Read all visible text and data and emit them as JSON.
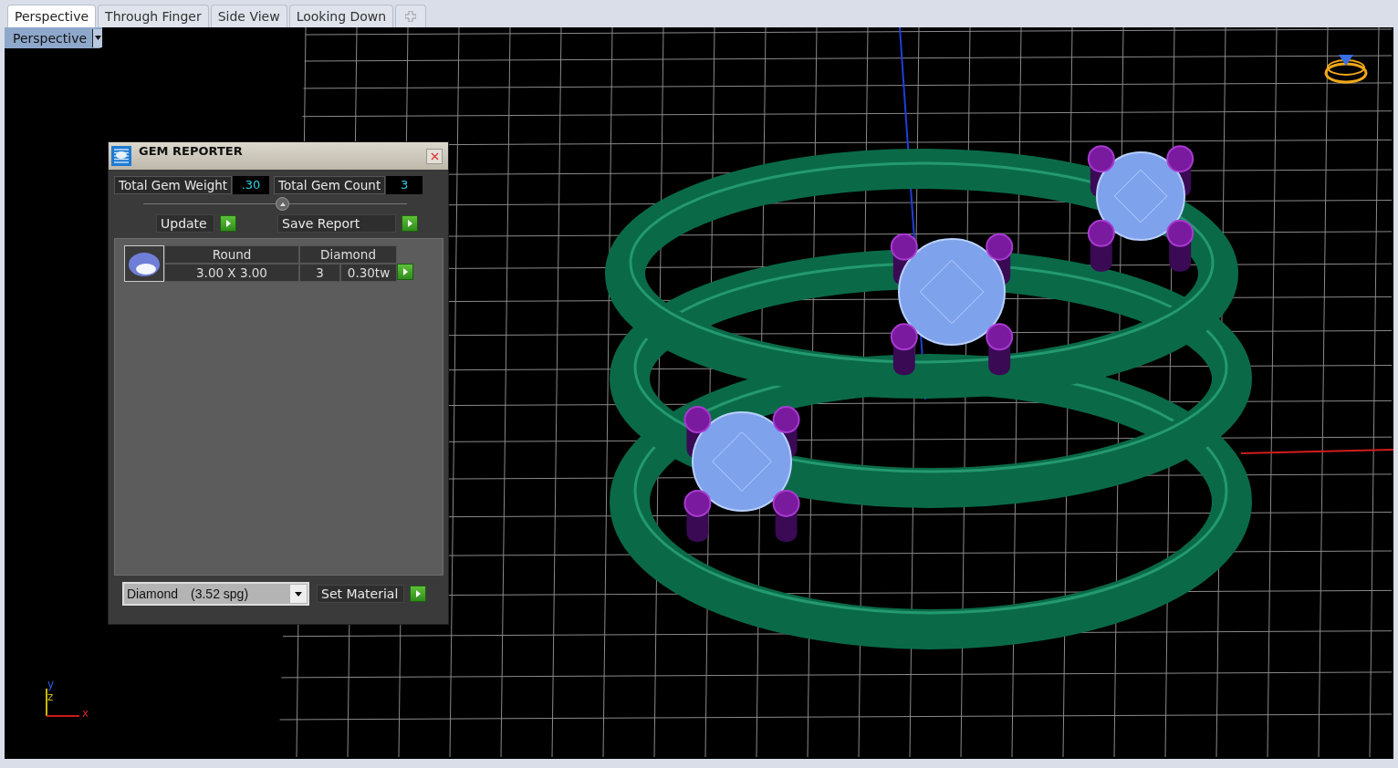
{
  "tabs": [
    {
      "label": "Perspective",
      "selected": true
    },
    {
      "label": "Through Finger",
      "selected": false
    },
    {
      "label": "Side View",
      "selected": false
    },
    {
      "label": "Looking Down",
      "selected": false
    }
  ],
  "viewport": {
    "label": "Perspective",
    "axes": {
      "y": "y",
      "z": "z",
      "x": "x"
    }
  },
  "gem_reporter": {
    "title": "GEM REPORTER",
    "totals": [
      {
        "label": "Total Gem Weight",
        "value": ".30"
      },
      {
        "label": "Total Gem Count",
        "value": "3"
      }
    ],
    "buttons": [
      "Update",
      "Save Report"
    ],
    "gems": [
      {
        "shape": "Round",
        "material": "Diamond",
        "size": "3.00 X 3.00",
        "count": "3",
        "weight": "0.30tw"
      }
    ],
    "material": {
      "name": "Diamond",
      "gravity": "(3.52 spg)"
    },
    "set_material": "Set Material"
  }
}
